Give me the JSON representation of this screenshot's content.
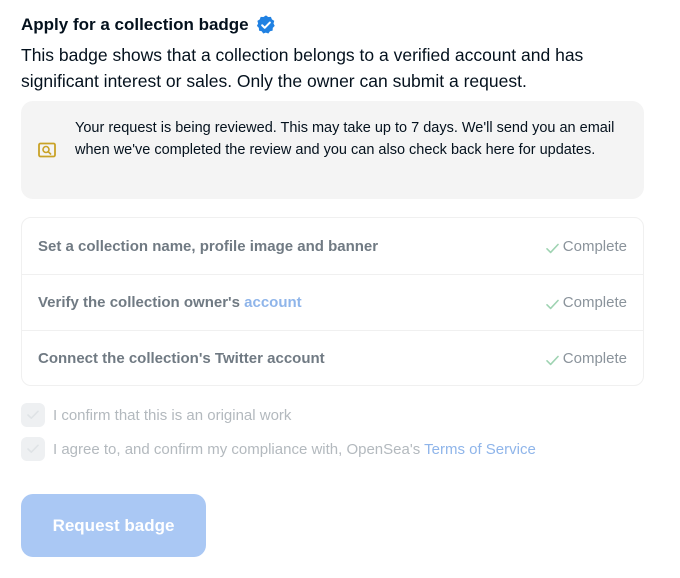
{
  "header": {
    "title": "Apply for a collection badge",
    "verified_icon": "verified-badge-icon",
    "description": "This badge shows that a collection belongs to a verified account and has significant interest or sales. Only the owner can submit a request."
  },
  "notice": {
    "icon": "review-search-icon",
    "text": "Your request is being reviewed. This may take up to 7 days. We'll send you an email when we've completed the review and you can also check back here for updates."
  },
  "steps": [
    {
      "label": "Set a collection name, profile image and banner",
      "link": "",
      "status": "Complete"
    },
    {
      "label": "Verify the collection owner's ",
      "link": "account",
      "status": "Complete"
    },
    {
      "label": "Connect the collection's Twitter account",
      "link": "",
      "status": "Complete"
    }
  ],
  "confirmations": [
    {
      "text": "I confirm that this is an original work",
      "link": ""
    },
    {
      "text": "I agree to, and confirm my compliance with, OpenSea's ",
      "link": "Terms of Service"
    }
  ],
  "actions": {
    "request_label": "Request badge"
  },
  "colors": {
    "accent": "#2081e2",
    "accent_disabled": "#aac8f4",
    "link_muted": "#8fb5ea",
    "check_green": "#9fd3b2",
    "notice_icon": "#c9a227"
  }
}
